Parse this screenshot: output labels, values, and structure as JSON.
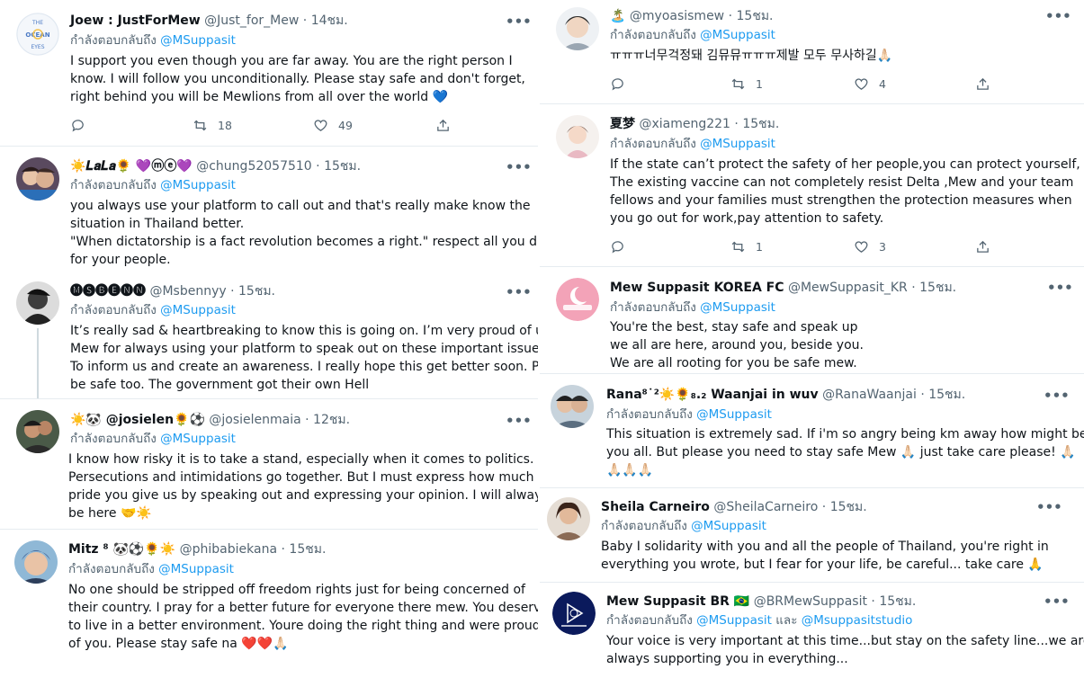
{
  "reply_prefix": "กำลังตอบกลับถึง",
  "left_column": [
    {
      "name": "Joew : JustForMew",
      "handle": "@Just_for_Mew",
      "time": "14ชม.",
      "reply_to": "@MSuppasit",
      "text": [
        "I support you even though you are far away. You are the right person I",
        "know.  I will follow you unconditionally.  Please stay safe and don't forget,",
        "right behind you will be Mewlions from all over the world 💙"
      ],
      "replies": "",
      "retweets": "18",
      "likes": "49"
    },
    {
      "name": "☀️𝑳𝒂𝑳𝒂🌻 💜ⓜⓔ💜",
      "handle": "@chung52057510",
      "time": "15ชม.",
      "reply_to": "@MSuppasit",
      "text": [
        "you always use your platform to call out and that's really make know the",
        "situation in Thailand better.",
        "\"When dictatorship is a fact revolution becomes a right.\" respect all you did",
        "for your people."
      ]
    },
    {
      "name": "🅜🅢🅑🅔🅝🅝",
      "handle": "@Msbennyy",
      "time": "15ชม.",
      "reply_to": "@MSuppasit",
      "text": [
        "It’s really sad & heartbreaking to know this is going on. I’m very proud of u",
        "Mew for always using your platform to speak out on these important issues.",
        "To inform us and create an awareness. I really hope this get better soon. Pls",
        "be safe too. The government got their own Hell"
      ]
    },
    {
      "name": "☀️🐼 @josielen🌻⚽",
      "handle": "@josielenmaia",
      "time": "12ชม.",
      "reply_to": "@MSuppasit",
      "text": [
        "I know how risky it is to take a stand, especially when it comes to politics.",
        "Persecutions and intimidations go together. But I must express how much",
        "pride you give us by speaking out and expressing your opinion. I will always",
        "be here 🤝☀️"
      ]
    },
    {
      "name": "Mitz ⁸ 🐼⚽🌻☀️",
      "handle": "@phibabiekana",
      "time": "15ชม.",
      "reply_to": "@MSuppasit",
      "text": [
        "No one should be stripped off freedom rights just for being concerned of",
        "their country. I pray for a better future for everyone there mew. You deserve",
        "to live in a better environment. Youre doing the right thing and were proud",
        "of you. Please stay safe na ❤️❤️🙏🏻"
      ]
    }
  ],
  "right_column": [
    {
      "name": "🏝️",
      "handle": "@myoasismew",
      "time": "15ชม.",
      "reply_to": "@MSuppasit",
      "text": [
        "ㅠㅠㅠ너무걱정돼 김뮤뮤ㅠㅠㅠ제발 모두 무사하길🙏🏻"
      ],
      "replies": "",
      "retweets": "1",
      "likes": "4"
    },
    {
      "name": "夏梦",
      "handle": "@xiameng221",
      "time": "15ชม.",
      "reply_to": "@MSuppasit",
      "text": [
        "If the state can’t protect the safety of her people,you can protect yourself,",
        "The existing vaccine can not completely resist Delta ,Mew and your team",
        "fellows and your families must strengthen the protection measures when",
        "you go out for work,pay attention to safety."
      ],
      "replies": "",
      "retweets": "1",
      "likes": "3"
    },
    {
      "name": "Mew Suppasit KOREA FC",
      "handle": "@MewSuppasit_KR",
      "time": "15ชม.",
      "reply_to": "@MSuppasit",
      "text": [
        "You're the best, stay safe and speak up",
        "we all are here, around you, beside you.",
        "We are all rooting for you be safe mew."
      ]
    },
    {
      "name": "Rana⁸˙²☀️🌻₈.₂ Waanjai in wuv",
      "handle": "@RanaWaanjai",
      "time": "15ชม.",
      "reply_to": "@MSuppasit",
      "text": [
        "This situation is extremely sad. If i'm so angry being km away how might be",
        "you all. But please you need to stay safe Mew 🙏🏻  just take care please! 🙏🏻",
        "🙏🏻🙏🏻🙏🏻"
      ]
    },
    {
      "name": "Sheila Carneiro",
      "handle": "@SheilaCarneiro",
      "time": "15ชม.",
      "reply_to": "@MSuppasit",
      "text": [
        "Baby I solidarity with you and all the people of Thailand, you're right in",
        "everything you wrote, but I fear for your life, be careful... take care 🙏"
      ]
    },
    {
      "name": "Mew Suppasit BR 🇧🇷",
      "handle": "@BRMewSuppasit",
      "time": "15ชม.",
      "reply_to": "@MSuppasit",
      "reply_and": "และ",
      "reply_to_2": "@Msuppasitstudio",
      "text": [
        "Your voice is very important at this time...but stay on the safety line...we are",
        "always supporting you in everything..."
      ]
    }
  ],
  "logo_text": [
    "THE",
    "OCEAN",
    "EYES"
  ],
  "more_label": "•••",
  "colors": {
    "accent": "#1d9bf0",
    "muted": "#536471",
    "divider": "#e6ecf0"
  }
}
